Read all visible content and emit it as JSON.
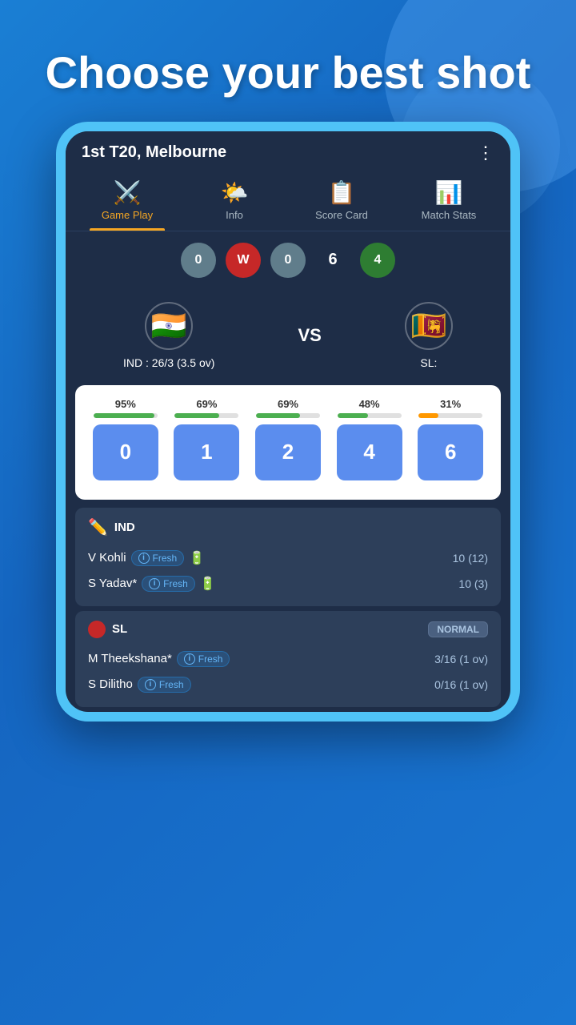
{
  "background": {
    "color": "#1a7fd4"
  },
  "headline": "Choose your best shot",
  "match": {
    "title": "1st T20, Melbourne",
    "menu_icon": "⋮"
  },
  "nav": {
    "tabs": [
      {
        "id": "gameplay",
        "label": "Game Play",
        "icon": "⚔️",
        "active": true
      },
      {
        "id": "info",
        "label": "Info",
        "icon": "🌤️",
        "active": false
      },
      {
        "id": "scorecard",
        "label": "Score Card",
        "icon": "📋",
        "active": false
      },
      {
        "id": "matchstats",
        "label": "Match Stats",
        "icon": "📊",
        "active": false
      }
    ]
  },
  "score_balls": [
    {
      "value": "0",
      "type": "grey"
    },
    {
      "value": "W",
      "type": "red"
    },
    {
      "value": "0",
      "type": "grey"
    },
    {
      "value": "6",
      "type": "plain"
    },
    {
      "value": "4",
      "type": "green"
    }
  ],
  "teams": {
    "team1": {
      "name": "IND",
      "flag_emoji": "🇮🇳",
      "score": "IND : 26/3 (3.5 ov)"
    },
    "vs": "VS",
    "team2": {
      "name": "SL",
      "flag_emoji": "🇱🇰",
      "score": "SL:"
    }
  },
  "shot_options": [
    {
      "value": "0",
      "pct": "95%",
      "pct_num": 95,
      "color": "green"
    },
    {
      "value": "1",
      "pct": "69%",
      "pct_num": 69,
      "color": "green"
    },
    {
      "value": "2",
      "pct": "69%",
      "pct_num": 69,
      "color": "green"
    },
    {
      "value": "4",
      "pct": "48%",
      "pct_num": 48,
      "color": "green"
    },
    {
      "value": "6",
      "pct": "31%",
      "pct_num": 31,
      "color": "orange"
    }
  ],
  "batting_panel": {
    "team": "IND",
    "icon": "✏️",
    "players": [
      {
        "name": "V Kohli",
        "status": "Fresh",
        "score": "10 (12)"
      },
      {
        "name": "S Yadav*",
        "status": "Fresh",
        "score": "10 (3)"
      }
    ]
  },
  "bowling_panel": {
    "team": "SL",
    "badge": "NORMAL",
    "players": [
      {
        "name": "M Theekshana*",
        "status": "Fresh",
        "score": "3/16 (1 ov)"
      },
      {
        "name": "S Dilitho",
        "status": "Fresh",
        "score": "0/16 (1 ov)"
      }
    ]
  }
}
